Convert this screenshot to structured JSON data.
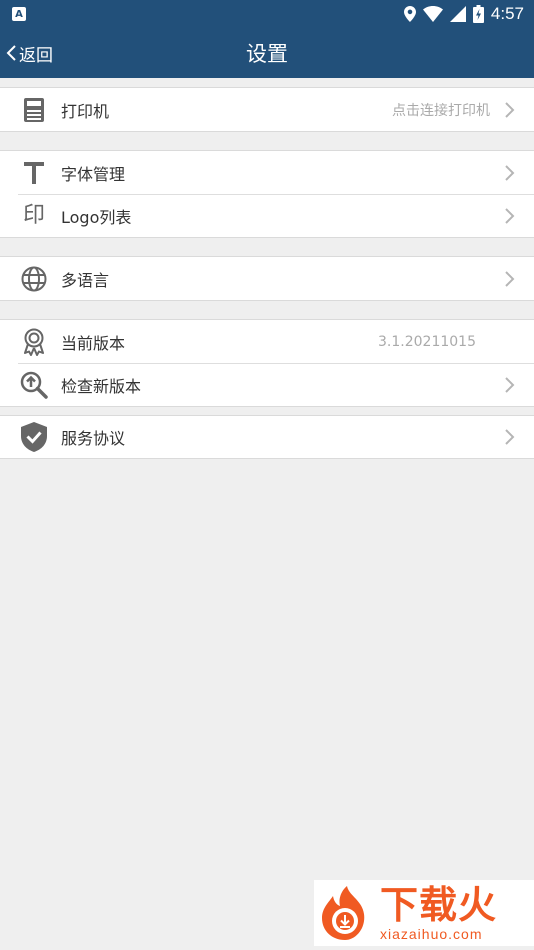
{
  "status_bar": {
    "app_icon_letter": "A",
    "time": "4:57"
  },
  "nav": {
    "back_label": "返回",
    "title": "设置"
  },
  "groups": [
    {
      "items": [
        {
          "icon": "printer-icon",
          "label": "打印机",
          "value": "点击连接打印机",
          "chevron": true
        }
      ]
    },
    {
      "items": [
        {
          "icon": "font-icon",
          "label": "字体管理",
          "value": "",
          "chevron": true
        },
        {
          "icon": "stamp-icon",
          "icon_text": "印",
          "label": "Logo列表",
          "value": "",
          "chevron": true
        }
      ]
    },
    {
      "items": [
        {
          "icon": "globe-icon",
          "label": "多语言",
          "value": "",
          "chevron": true
        }
      ]
    },
    {
      "items": [
        {
          "icon": "badge-icon",
          "label": "当前版本",
          "value": "3.1.20211015",
          "chevron": false
        },
        {
          "icon": "update-search-icon",
          "label": "检查新版本",
          "value": "",
          "chevron": true
        }
      ]
    },
    {
      "items": [
        {
          "icon": "shield-check-icon",
          "label": "服务协议",
          "value": "",
          "chevron": true
        }
      ]
    }
  ],
  "watermark": {
    "brand_cn": "下载火",
    "url": "xiazaihuo.com"
  },
  "colors": {
    "header_bg": "#22507a",
    "page_bg": "#efefef",
    "icon_gray": "#666666",
    "watermark_orange": "#f05a22"
  }
}
